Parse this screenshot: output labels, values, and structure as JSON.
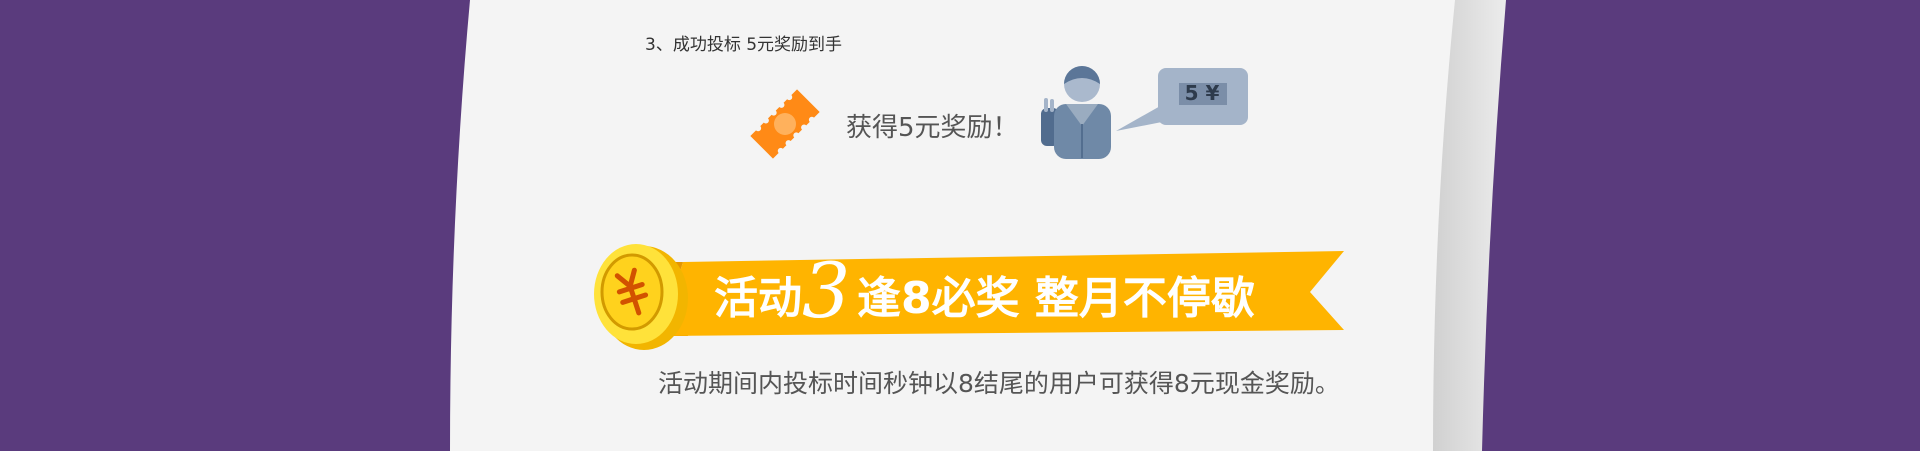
{
  "step": {
    "text": "3、成功投标 5元奖励到手"
  },
  "reward": {
    "text": "获得5元奖励！",
    "bubble_label": "5 ¥"
  },
  "banner": {
    "activity_label": "活动",
    "activity_number": "3",
    "slogan": "逢8必奖 整月不停歇"
  },
  "description": {
    "text": "活动期间内投标时间秒钟以8结尾的用户可获得8元现金奖励。"
  },
  "colors": {
    "background": "#5a3b7d",
    "paper": "#f4f4f4",
    "banner_orange": "#ffb400",
    "ticket_orange": "#ff8a16",
    "coin_yellow": "#ffe23a",
    "figure_blue": "#6f89a7",
    "bubble_blue": "#a4b4c9"
  }
}
